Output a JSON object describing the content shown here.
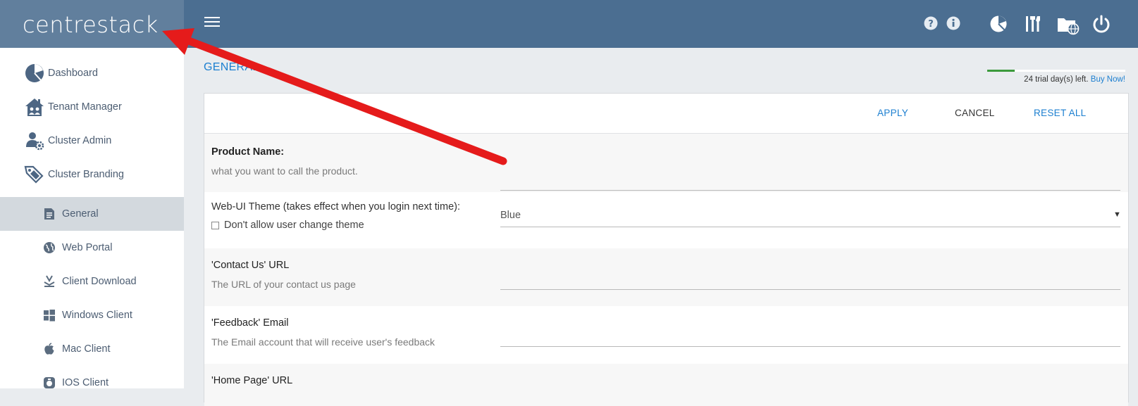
{
  "header": {
    "logo_text": "centrestack",
    "menu_icon": "hamburger-menu-icon",
    "icons": [
      "help-icon",
      "info-icon",
      "dashboard-pie-icon",
      "tools-icon",
      "web-folder-icon",
      "power-icon"
    ]
  },
  "sidebar": {
    "items": [
      {
        "label": "Dashboard",
        "icon": "dashboard-pie-icon"
      },
      {
        "label": "Tenant Manager",
        "icon": "tenant-house-icon"
      },
      {
        "label": "Cluster Admin",
        "icon": "cluster-admin-gear-icon"
      },
      {
        "label": "Cluster Branding",
        "icon": "branding-tag-icon",
        "expanded": true
      }
    ],
    "sub_items": [
      {
        "label": "General",
        "icon": "document-icon",
        "active": true
      },
      {
        "label": "Web Portal",
        "icon": "globe-icon"
      },
      {
        "label": "Client Download",
        "icon": "download-icon"
      },
      {
        "label": "Windows Client",
        "icon": "windows-icon"
      },
      {
        "label": "Mac Client",
        "icon": "apple-icon"
      },
      {
        "label": "IOS Client",
        "icon": "ios-icon"
      }
    ]
  },
  "main": {
    "title": "GENERAL",
    "trial": {
      "text": "24 trial day(s) left.",
      "link": "Buy Now!",
      "progress": 0.2
    },
    "actions": {
      "apply": "APPLY",
      "cancel": "CANCEL",
      "reset_all": "RESET ALL"
    },
    "fields": {
      "product_name": {
        "label": "Product Name:",
        "desc": "what you want to call the product.",
        "value": ""
      },
      "theme": {
        "label": "Web-UI Theme (takes effect when you login next time):",
        "checkbox_label": "Don't allow user change theme",
        "checkbox_checked": false,
        "selected": "Blue"
      },
      "contact_url": {
        "label": "'Contact Us' URL",
        "desc": "The URL of your contact us page",
        "value": ""
      },
      "feedback_email": {
        "label": "'Feedback' Email",
        "desc": "The Email account that will receive user's feedback",
        "value": ""
      },
      "home_page_url": {
        "label": "'Home Page' URL"
      }
    }
  },
  "colors": {
    "topbar": "#4b6e91",
    "logo_bg": "#617f9d",
    "accent": "#1c7fd0",
    "annotation_arrow": "#e51b1b"
  }
}
